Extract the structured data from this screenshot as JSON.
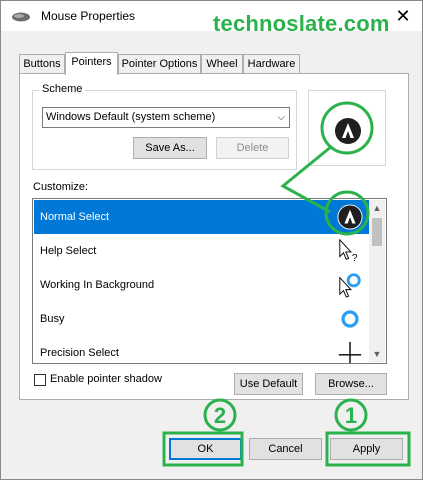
{
  "window": {
    "title": "Mouse Properties",
    "close_glyph": "✕",
    "watermark": "technoslate.com"
  },
  "tabs": [
    {
      "label": "Buttons",
      "active": false
    },
    {
      "label": "Pointers",
      "active": true
    },
    {
      "label": "Pointer Options",
      "active": false
    },
    {
      "label": "Wheel",
      "active": false
    },
    {
      "label": "Hardware",
      "active": false
    }
  ],
  "scheme": {
    "legend": "Scheme",
    "selected": "Windows Default (system scheme)",
    "save_as_label": "Save As...",
    "delete_label": "Delete"
  },
  "customize": {
    "label": "Customize:",
    "items": [
      {
        "label": "Normal Select",
        "icon": "custom-pointer-icon",
        "selected": true
      },
      {
        "label": "Help Select",
        "icon": "help-select-cursor-icon",
        "selected": false
      },
      {
        "label": "Working In Background",
        "icon": "working-background-cursor-icon",
        "selected": false
      },
      {
        "label": "Busy",
        "icon": "busy-cursor-icon",
        "selected": false
      },
      {
        "label": "Precision Select",
        "icon": "crosshair-cursor-icon",
        "selected": false
      }
    ]
  },
  "options": {
    "shadow_label": "Enable pointer shadow",
    "shadow_checked": false,
    "use_default_label": "Use Default",
    "browse_label": "Browse..."
  },
  "footer": {
    "ok_label": "OK",
    "cancel_label": "Cancel",
    "apply_label": "Apply"
  },
  "annotations": {
    "color": "#2bb24c",
    "step1": "1",
    "step2": "2"
  }
}
